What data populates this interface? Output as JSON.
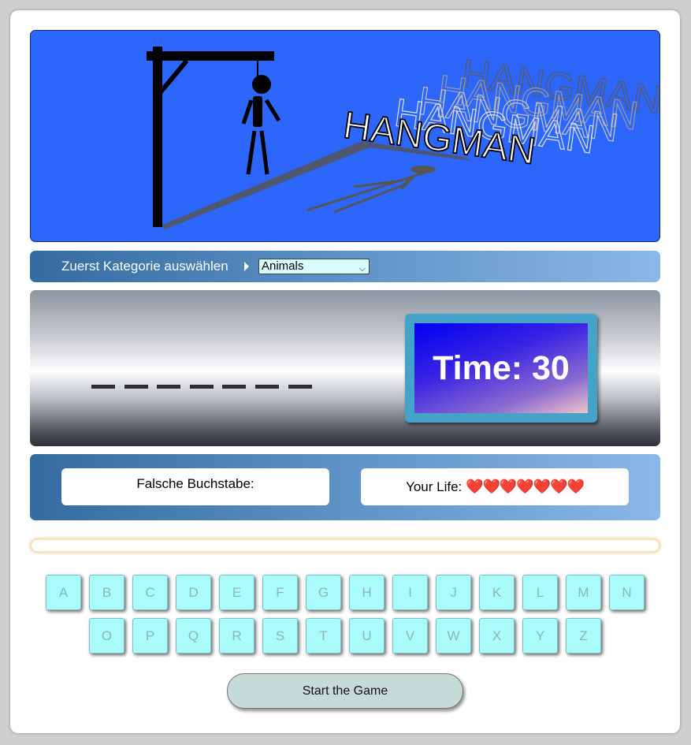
{
  "banner": {
    "logo_text": "HANGMAN"
  },
  "category": {
    "label": "Zuerst Kategorie auswählen",
    "selected": "Animals"
  },
  "word": {
    "letter_count": 7
  },
  "timer": {
    "text": "Time: 30"
  },
  "status": {
    "wrong_label": "Falsche Buchstabe:",
    "life_label": "Your Life:",
    "lives": 7,
    "heart_icon": "❤️"
  },
  "message": "",
  "keyboard": {
    "row1": [
      "A",
      "B",
      "C",
      "D",
      "E",
      "F",
      "G",
      "H",
      "I",
      "J",
      "K",
      "L",
      "M",
      "N"
    ],
    "row2": [
      "O",
      "P",
      "Q",
      "R",
      "S",
      "T",
      "U",
      "V",
      "W",
      "X",
      "Y",
      "Z"
    ]
  },
  "start_button": "Start the Game"
}
